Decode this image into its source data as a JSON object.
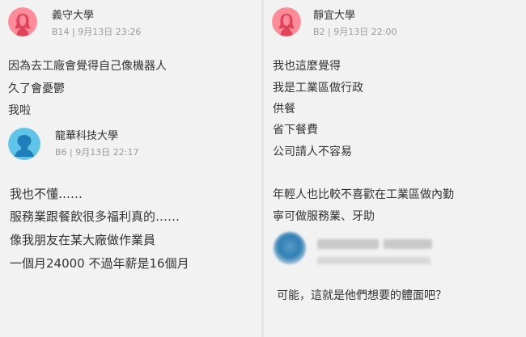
{
  "colors": {
    "female_avatar_bg": "#ff8c98",
    "male_avatar_bg": "#5ec4e8",
    "blurred_avatar": "#2f7fb4"
  },
  "left": {
    "post1": {
      "avatar_icon": "female-avatar-icon",
      "school": "義守大學",
      "meta": "B14 | 9月13日 23:26",
      "lines": [
        "因為去工廠會覺得自己像機器人",
        "久了會憂鬱",
        "我啦"
      ]
    },
    "post2": {
      "avatar_icon": "male-avatar-icon",
      "school": "龍華科技大學",
      "meta": "B6 | 9月13日 22:17",
      "lines": [
        "我也不懂……",
        "服務業跟餐飲很多福利真的……",
        "像我朋友在某大廠做作業員",
        "一個月24000 不過年薪是16個月"
      ]
    }
  },
  "right": {
    "post1": {
      "avatar_icon": "female-avatar-icon",
      "school": "靜宜大學",
      "meta": "B2 | 9月13日 22:00",
      "lines": [
        "我也這麼覺得",
        "我是工業區做行政",
        "供餐",
        "省下餐費",
        "公司請人不容易"
      ],
      "lines2": [
        "年輕人也比較不喜歡在工業區做內勤",
        "寧可做服務業、牙助"
      ]
    },
    "post2": {
      "avatar_icon": "blurred-avatar-icon",
      "line": "可能，這就是他們想要的體面吧？"
    }
  }
}
